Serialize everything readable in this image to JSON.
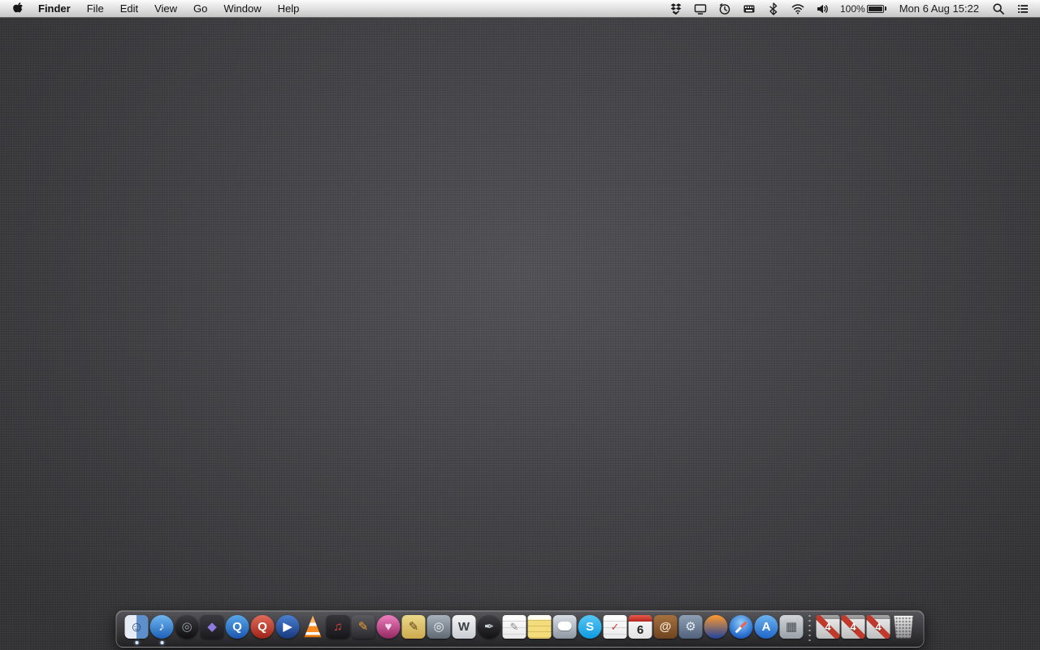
{
  "menubar": {
    "app_menu": "Finder",
    "items": [
      "File",
      "Edit",
      "View",
      "Go",
      "Window",
      "Help"
    ],
    "status": {
      "battery": "100%",
      "clock": "Mon 6 Aug 15:22"
    }
  },
  "colors": {
    "menubar_text": "#111111",
    "desktop_base": "#47474b",
    "dock_border": "#ffffff",
    "running_dot": "#d9ecff",
    "calendar_red": "#c93a2e"
  },
  "dock": {
    "items": [
      {
        "name": "finder",
        "shape": "finder",
        "glyph": "☺",
        "fg": "#1f3f6e",
        "running": true
      },
      {
        "name": "itunes",
        "shape": "circle",
        "glyph": "♪",
        "bg1": "#6fb7f0",
        "bg2": "#1d5fb8",
        "fg": "#ffffff",
        "running": true
      },
      {
        "name": "aperture",
        "shape": "circle",
        "glyph": "◎",
        "bg1": "#3c3c40",
        "bg2": "#0f0f11",
        "fg": "#9aa0a8",
        "running": false
      },
      {
        "name": "final-cut-pro",
        "shape": "square",
        "glyph": "◆",
        "bg1": "#3a3a40",
        "bg2": "#1b1b1f",
        "fg": "#8f7be0",
        "running": false
      },
      {
        "name": "quicktime-blue",
        "shape": "circle",
        "glyph": "Q",
        "bg1": "#58a6e8",
        "bg2": "#1a56b0",
        "fg": "#ffffff",
        "running": false
      },
      {
        "name": "quicktime-red",
        "shape": "circle",
        "glyph": "Q",
        "bg1": "#e06a5a",
        "bg2": "#9e2317",
        "fg": "#ffffff",
        "running": false
      },
      {
        "name": "media-player",
        "shape": "circle",
        "glyph": "▶",
        "bg1": "#4a7fd0",
        "bg2": "#17387e",
        "fg": "#ffffff",
        "running": false
      },
      {
        "name": "vlc",
        "shape": "cone",
        "glyph": "",
        "running": false
      },
      {
        "name": "audio-app",
        "shape": "square",
        "glyph": "♫",
        "bg1": "#35353a",
        "bg2": "#17171a",
        "fg": "#e0483c",
        "running": false
      },
      {
        "name": "design-tool",
        "shape": "square",
        "glyph": "✎",
        "bg1": "#5a5a60",
        "bg2": "#2a2a2e",
        "fg": "#f0a030",
        "running": false
      },
      {
        "name": "heart-sphere-app",
        "shape": "circle",
        "glyph": "♥",
        "bg1": "#ef7ec0",
        "bg2": "#93275f",
        "fg": "#ffd9ee",
        "running": false
      },
      {
        "name": "sketch-pad",
        "shape": "square",
        "glyph": "✎",
        "bg1": "#ecd98a",
        "bg2": "#cda94e",
        "fg": "#5a4414",
        "running": false
      },
      {
        "name": "image-capture",
        "shape": "square",
        "glyph": "◎",
        "bg1": "#a8b2bc",
        "bg2": "#5f6974",
        "fg": "#eef2f6",
        "running": false
      },
      {
        "name": "word-w",
        "shape": "square",
        "glyph": "W",
        "bg1": "#f4f4f4",
        "bg2": "#c9ced4",
        "fg": "#3c3f44",
        "running": false
      },
      {
        "name": "pen-circle-app",
        "shape": "circle",
        "glyph": "✒",
        "bg1": "#3e3e44",
        "bg2": "#121214",
        "fg": "#cfd4da",
        "running": false
      },
      {
        "name": "textedit",
        "shape": "page",
        "glyph": "✎",
        "fg": "#8a8a8a",
        "running": false
      },
      {
        "name": "notes",
        "shape": "notes",
        "glyph": "",
        "running": false
      },
      {
        "name": "messages",
        "shape": "bubble",
        "glyph": "",
        "bg1": "#d9dee4",
        "bg2": "#8d97a2",
        "running": false
      },
      {
        "name": "skype",
        "shape": "circle",
        "glyph": "S",
        "bg1": "#57c7f5",
        "bg2": "#0f9ae0",
        "fg": "#ffffff",
        "running": false
      },
      {
        "name": "reminders",
        "shape": "page",
        "glyph": "✓",
        "fg": "#c04040",
        "running": false
      },
      {
        "name": "calendar",
        "shape": "calendar",
        "glyph": "6",
        "running": false
      },
      {
        "name": "contacts",
        "shape": "square",
        "glyph": "@",
        "bg1": "#a5713f",
        "bg2": "#6f441f",
        "fg": "#f3e6d2",
        "running": false
      },
      {
        "name": "utility-app",
        "shape": "square",
        "glyph": "⚙",
        "bg1": "#8fa0b4",
        "bg2": "#50627a",
        "fg": "#e8eef6",
        "running": false
      },
      {
        "name": "firefox",
        "shape": "circle",
        "glyph": "",
        "bg1": "#ff9a2e",
        "bg2": "#20449c",
        "running": false
      },
      {
        "name": "safari",
        "shape": "safari",
        "glyph": "",
        "running": false
      },
      {
        "name": "app-store",
        "shape": "circle",
        "glyph": "A",
        "bg1": "#6cb2ee",
        "bg2": "#1f66c9",
        "fg": "#ffffff",
        "running": false
      },
      {
        "name": "grid-app",
        "shape": "square",
        "glyph": "▦",
        "bg1": "#d2d6da",
        "bg2": "#9aa0a8",
        "fg": "#4a4e54",
        "running": false
      }
    ],
    "minimized": [
      {
        "name": "minimized-window-1",
        "shape": "windowthumb",
        "glyph": "4",
        "running": false
      },
      {
        "name": "minimized-window-2",
        "shape": "windowthumb",
        "glyph": "4",
        "running": false
      },
      {
        "name": "minimized-window-3",
        "shape": "windowthumb",
        "glyph": "4",
        "running": false
      }
    ],
    "trash": {
      "name": "trash",
      "shape": "trash",
      "glyph": "",
      "running": false
    }
  }
}
